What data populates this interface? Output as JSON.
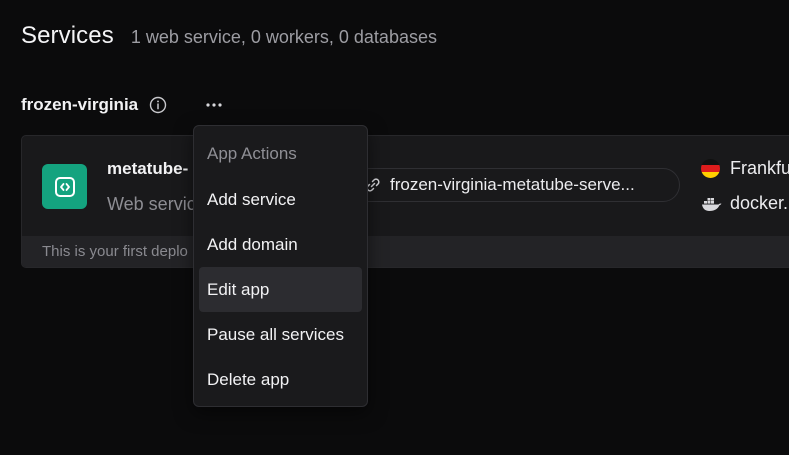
{
  "header": {
    "title": "Services",
    "summary": "1 web service, 0 workers, 0 databases"
  },
  "app": {
    "name": "frozen-virginia",
    "info_icon": "info-icon",
    "more_icon": "more-horizontal-icon"
  },
  "service": {
    "name": "metatube-",
    "type": "Web servic",
    "icon": "code-brackets-icon",
    "url": "frozen-virginia-metatube-serve...",
    "region": "Frankfu",
    "image": "docker.",
    "footer_note": "This is your first deplo",
    "colors": {
      "icon_bg": "#14a37f"
    }
  },
  "menu": {
    "header": "App Actions",
    "items": [
      {
        "label": "Add service",
        "active": false
      },
      {
        "label": "Add domain",
        "active": false
      },
      {
        "label": "Edit app",
        "active": true
      },
      {
        "label": "Pause all services",
        "active": false
      },
      {
        "label": "Delete app",
        "active": false
      }
    ]
  }
}
